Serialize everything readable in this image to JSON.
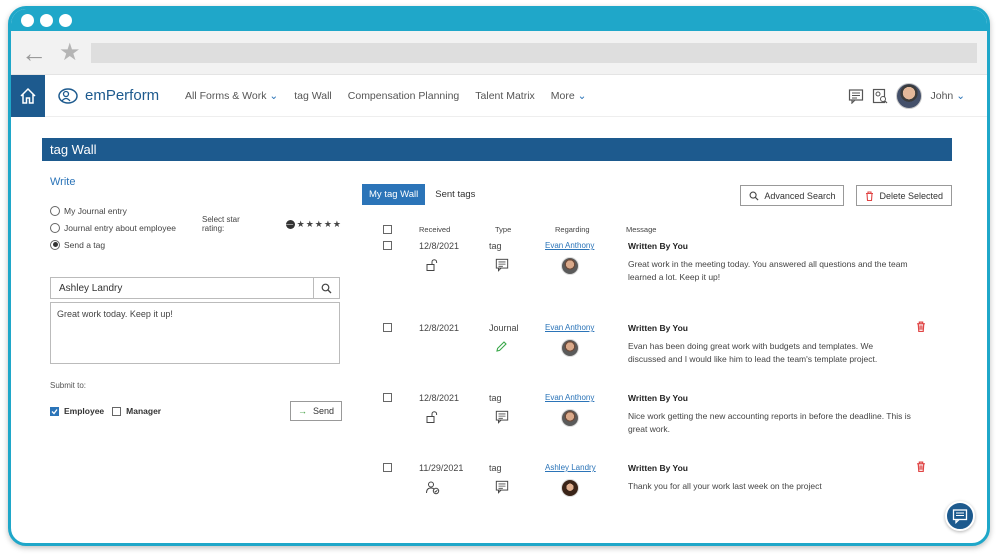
{
  "logo_text": "emPerform",
  "nav": {
    "items": [
      "All Forms & Work",
      "tag Wall",
      "Compensation Planning",
      "Talent Matrix",
      "More"
    ],
    "user": "John"
  },
  "section_title": "tag Wall",
  "write": {
    "title": "Write",
    "options": [
      "My Journal entry",
      "Journal entry about employee",
      "Send a tag"
    ],
    "selected": "Send a tag",
    "star_label": "Select star rating:",
    "employee_value": "Ashley Landry",
    "message_value": "Great work today. Keep it up!",
    "submit_label": "Submit to:",
    "employee_label": "Employee",
    "manager_label": "Manager",
    "send_label": "Send"
  },
  "tabs": {
    "active": "My tag Wall",
    "other": "Sent tags"
  },
  "actions": {
    "advanced_search": "Advanced Search",
    "delete_selected": "Delete Selected"
  },
  "table": {
    "headers": {
      "received": "Received",
      "type": "Type",
      "regarding": "Regarding",
      "message": "Message"
    },
    "rows": [
      {
        "date": "12/8/2021",
        "type": "tag",
        "regarding": "Evan Anthony",
        "title": "Written By You",
        "message": "Great work in the meeting today. You answered all questions and the team learned a lot. Keep it up!"
      },
      {
        "date": "12/8/2021",
        "type": "Journal",
        "regarding": "Evan Anthony",
        "title": "Written By You",
        "message": "Evan has been doing great work with budgets and templates. We discussed and I would like him to lead the team's template project."
      },
      {
        "date": "12/8/2021",
        "type": "tag",
        "regarding": "Evan Anthony",
        "title": "Written By You",
        "message": "Nice work getting the new accounting reports in before the deadline. This is great work."
      },
      {
        "date": "11/29/2021",
        "type": "tag",
        "regarding": "Ashley Landry",
        "title": "Written By You",
        "message": "Thank you for all your work last week on the project"
      }
    ]
  }
}
